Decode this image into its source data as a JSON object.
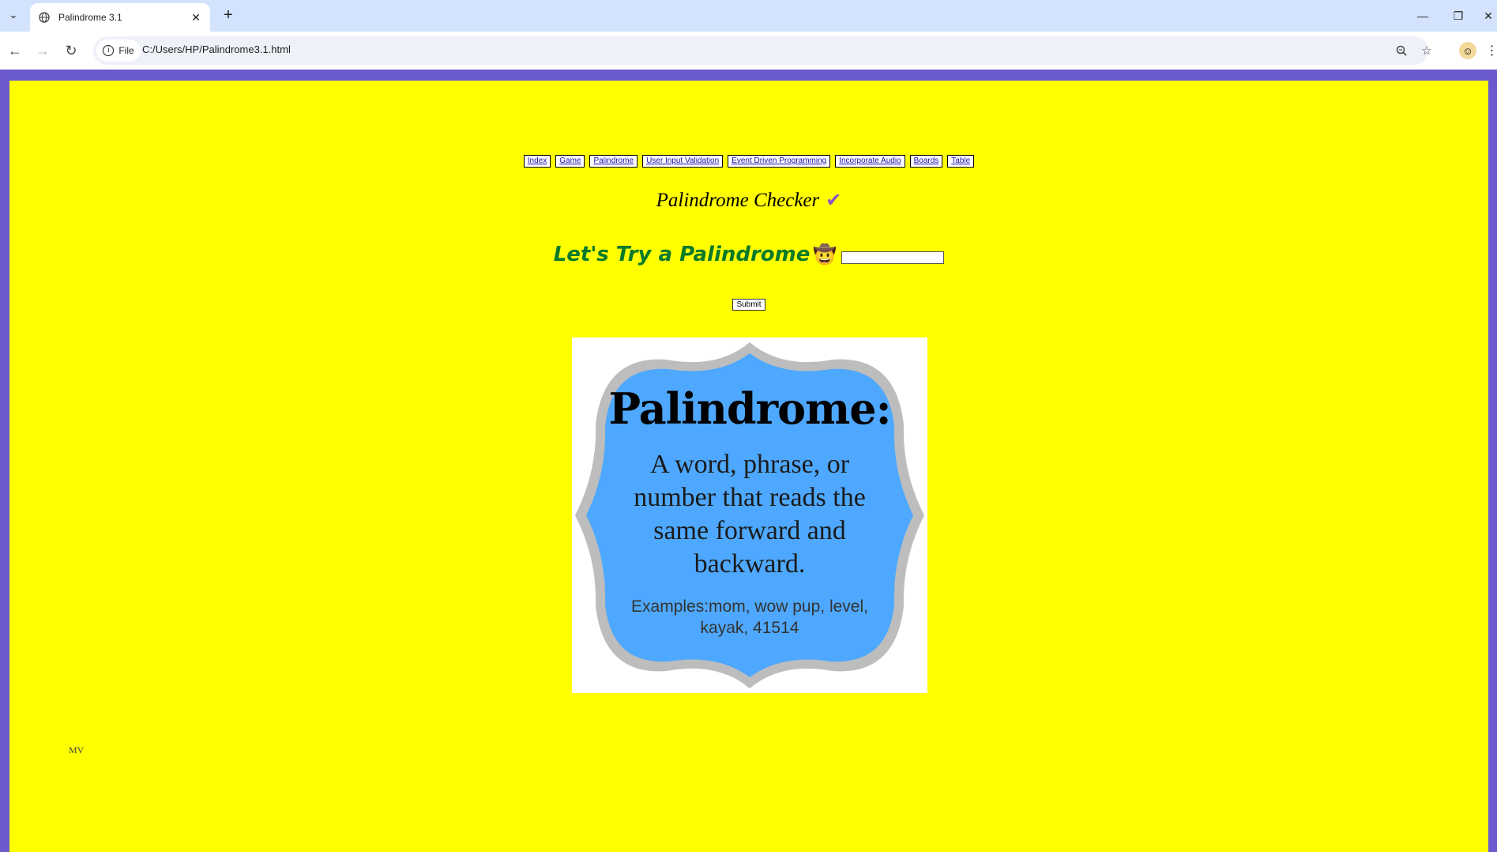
{
  "browser": {
    "tab_title": "Palindrome 3.1",
    "site_label": "File",
    "url": "C:/Users/HP/Palindrome3.1.html"
  },
  "nav": {
    "links": [
      "Index",
      "Game",
      "Palindrome",
      "User Input Validation",
      "Event Driven Programming",
      "Incorporate Audio",
      "Boards",
      "Table"
    ]
  },
  "page": {
    "heading": "Palindrome Checker",
    "heading_icon": "check-mark-icon",
    "try_label": "Let's Try a Palindrome",
    "try_icon": "cowboy-face-icon",
    "input_value": "",
    "submit_label": "Submit",
    "footer": "MV"
  },
  "poster": {
    "title": "Palindrome:",
    "definition": "A word, phrase,  or number that reads the same forward and backward.",
    "examples": "Examples:mom, wow pup, level, kayak, 41514",
    "colors": {
      "fill": "#4ea8ff",
      "frame": "#bdbdbd",
      "background": "#ffffff"
    }
  },
  "colors": {
    "page_background": "#ffff00",
    "outer_border": "#6a5acd",
    "try_label": "#0a7a2a",
    "check_mark": "#8a52c8"
  }
}
